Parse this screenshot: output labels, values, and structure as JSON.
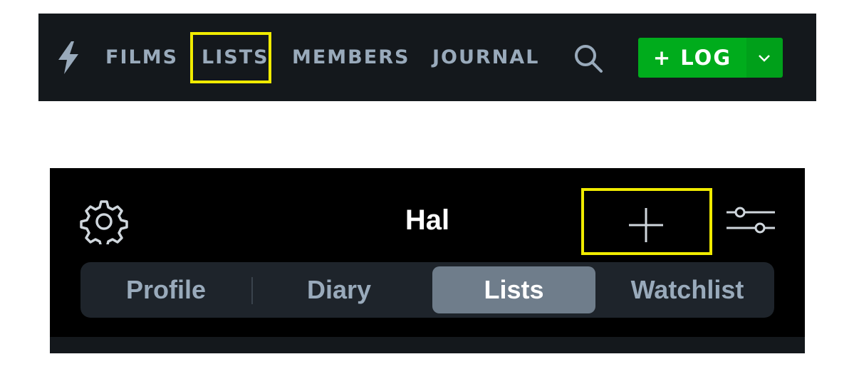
{
  "top_nav": {
    "logo_icon": "bolt-icon",
    "items": [
      {
        "label": "FILMS"
      },
      {
        "label": "LISTS",
        "highlighted": true
      },
      {
        "label": "MEMBERS"
      },
      {
        "label": "JOURNAL"
      }
    ],
    "search_icon": "search-icon",
    "log_button": {
      "label": "+ LOG",
      "color": "#00ac1c"
    },
    "log_caret_icon": "chevron-down-icon"
  },
  "mobile": {
    "settings_icon": "gear-icon",
    "title": "Hal",
    "add_icon": "plus-icon",
    "filter_icon": "sliders-icon",
    "tabs": [
      {
        "label": "Profile"
      },
      {
        "label": "Diary"
      },
      {
        "label": "Lists",
        "active": true
      },
      {
        "label": "Watchlist"
      }
    ]
  },
  "colors": {
    "highlight": "#f0eb00",
    "nav_bg": "#14181c",
    "accent_green": "#00ac1c"
  }
}
